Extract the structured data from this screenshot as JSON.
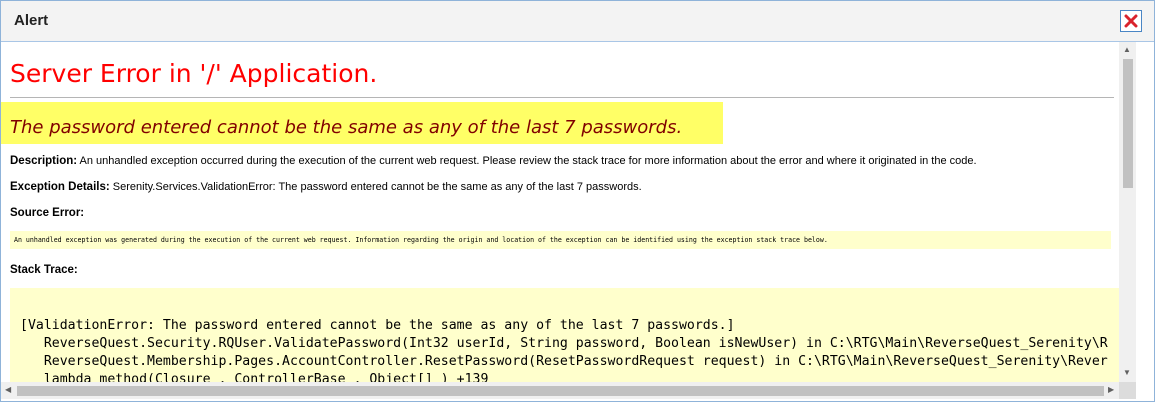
{
  "dialog": {
    "title": "Alert"
  },
  "error": {
    "heading": "Server Error in '/' Application.",
    "message": "The password entered cannot be the same as any of the last 7 passwords.",
    "description_label": "Description:",
    "description_text": "An unhandled exception occurred during the execution of the current web request. Please review the stack trace for more information about the error and where it originated in the code.",
    "exception_label": "Exception Details:",
    "exception_text": "Serenity.Services.ValidationError: The password entered cannot be the same as any of the last 7 passwords.",
    "source_label": "Source Error:",
    "source_text": "An unhandled exception was generated during the execution of the current web request. Information regarding the origin and location of the exception can be identified using the exception stack trace below.",
    "stack_label": "Stack Trace:",
    "stack_lines": [
      "[ValidationError: The password entered cannot be the same as any of the last 7 passwords.]",
      "   ReverseQuest.Security.RQUser.ValidatePassword(Int32 userId, String password, Boolean isNewUser) in C:\\RTG\\Main\\ReverseQuest_Serenity\\R",
      "   ReverseQuest.Membership.Pages.AccountController.ResetPassword(ResetPasswordRequest request) in C:\\RTG\\Main\\ReverseQuest_Serenity\\Rever",
      "   lambda_method(Closure , ControllerBase , Object[] ) +139"
    ]
  },
  "scrollbar": {
    "up_arrow": "▲",
    "down_arrow": "▼",
    "left_arrow": "◀",
    "right_arrow": "▶"
  },
  "colors": {
    "error_heading": "#ff0000",
    "error_message": "#800000",
    "highlight": "#ffff66",
    "code_background": "#ffffcc",
    "close_icon": "#d9232d"
  },
  "icons": {
    "close": "close-icon"
  }
}
